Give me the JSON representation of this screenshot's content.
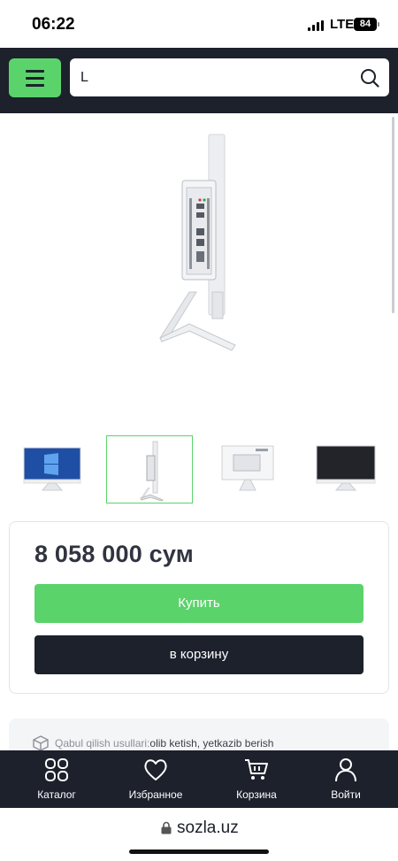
{
  "status_bar": {
    "time": "06:22",
    "network": "LTE",
    "battery": "84"
  },
  "header": {
    "search": {
      "value": "L"
    }
  },
  "product": {
    "price": "8 058 000 сум",
    "buy_label": "Купить",
    "cart_label": "в корзину",
    "thumbnails": [
      "front-view-windows",
      "side-view-ports",
      "back-view",
      "front-view-dark"
    ],
    "active_thumbnail": 1
  },
  "delivery": {
    "label": "Qabul qilish usullari:",
    "value": "olib ketish, yetkazib berish"
  },
  "bottom_nav": {
    "items": [
      {
        "label": "Каталог",
        "icon": "grid-icon"
      },
      {
        "label": "Избранное",
        "icon": "heart-icon"
      },
      {
        "label": "Корзина",
        "icon": "cart-icon"
      },
      {
        "label": "Войти",
        "icon": "user-icon"
      }
    ]
  },
  "browser": {
    "url": "sozla.uz"
  },
  "colors": {
    "accent": "#5bd36b",
    "dark": "#1c212c"
  }
}
